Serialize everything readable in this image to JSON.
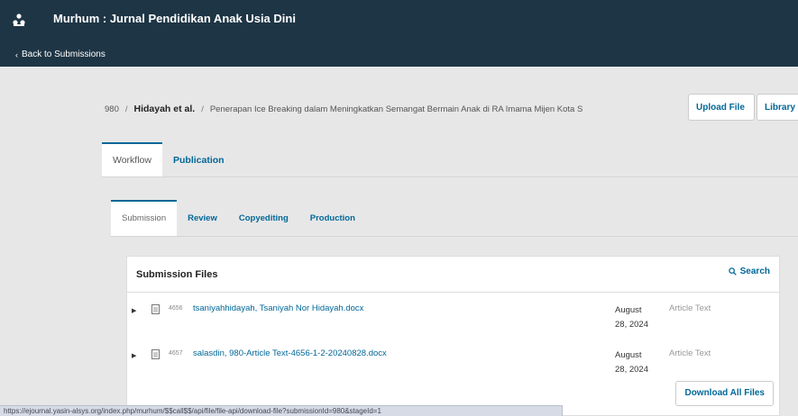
{
  "header": {
    "journal_title": "Murhum : Jurnal Pendidikan Anak Usia Dini",
    "back_label": "Back to Submissions"
  },
  "breadcrumb": {
    "id": "980",
    "authors": "Hidayah et al.",
    "title": "Penerapan Ice Breaking dalam Meningkatkan Semangat Bermain Anak di RA Imama Mijen Kota S"
  },
  "actions": {
    "upload": "Upload File",
    "library": "Library"
  },
  "main_tabs": [
    "Workflow",
    "Publication"
  ],
  "stage_tabs": [
    "Submission",
    "Review",
    "Copyediting",
    "Production"
  ],
  "files_panel": {
    "title": "Submission Files",
    "search_label": "Search",
    "download_label": "Download All Files",
    "files": [
      {
        "id": "4656",
        "name": "tsaniyahhidayah, Tsaniyah Nor Hidayah.docx",
        "date_month": "August",
        "date_day_year": "28, 2024",
        "type": "Article Text"
      },
      {
        "id": "4657",
        "name": "salasdin, 980-Article Text-4656-1-2-20240828.docx",
        "date_month": "August",
        "date_day_year": "28, 2024",
        "type": "Article Text"
      }
    ]
  },
  "status_bar": {
    "url": "https://ejournal.yasin-alsys.org/index.php/murhum/$$call$$/api/file/file-api/download-file?submissionId=980&stageId=1"
  },
  "colors": {
    "header_bg": "#1e3545",
    "accent": "#006798",
    "page_bg": "#e7e7e7"
  }
}
